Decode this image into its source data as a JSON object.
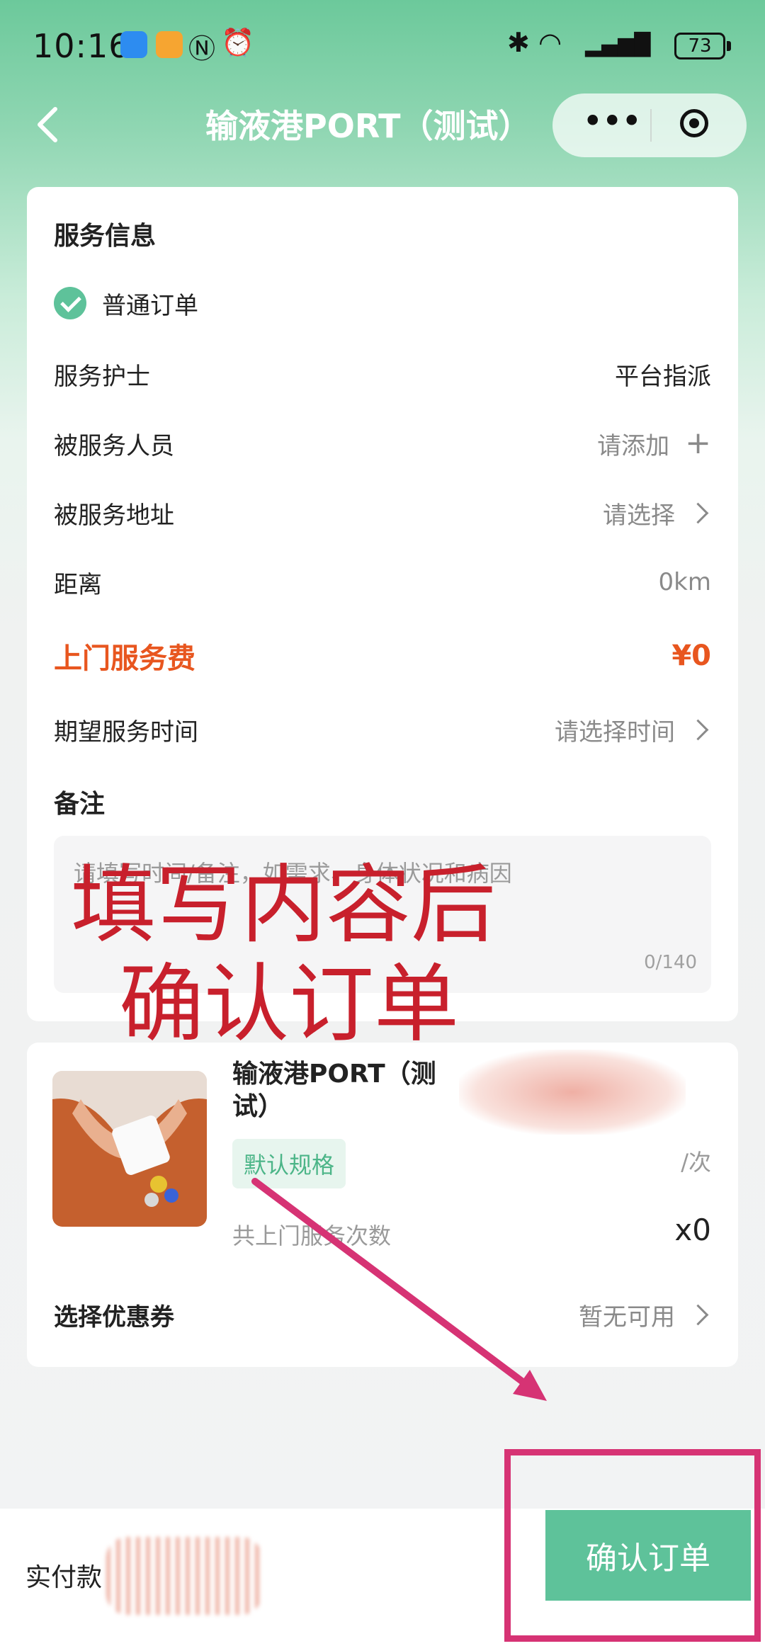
{
  "status_bar": {
    "time": "10:16",
    "battery": "73"
  },
  "nav": {
    "title": "输液港PORT（测试）"
  },
  "service": {
    "section_title": "服务信息",
    "order_type": "普通订单",
    "rows": [
      {
        "label": "服务护士",
        "value": "平台指派"
      },
      {
        "label": "被服务人员",
        "value": "请添加"
      },
      {
        "label": "被服务地址",
        "value": "请选择"
      },
      {
        "label": "距离",
        "value": "0km"
      }
    ],
    "fee_label": "上门服务费",
    "fee_value": "¥0",
    "time_label": "期望服务时间",
    "time_value": "请选择时间",
    "remark_title": "备注",
    "remark_placeholder": "请填写时间/备注，如需求、身体状况和病因",
    "remark_count": "0/140"
  },
  "annotation": {
    "line1": "填写内容后",
    "line2": "确认订单"
  },
  "product": {
    "title": "输液港PORT（测试）",
    "spec": "默认规格",
    "unit": "/次",
    "visits_label": "共上门服务次数",
    "visits_value": "x0",
    "coupon_label": "选择优惠券",
    "coupon_value": "暂无可用"
  },
  "bottom": {
    "pay_label": "实付款",
    "confirm": "确认订单"
  },
  "colors": {
    "brand_green": "#5ec29a",
    "fee_orange": "#e8561f",
    "annotation_red": "#c8202c",
    "highlight_pink": "#d63374"
  }
}
